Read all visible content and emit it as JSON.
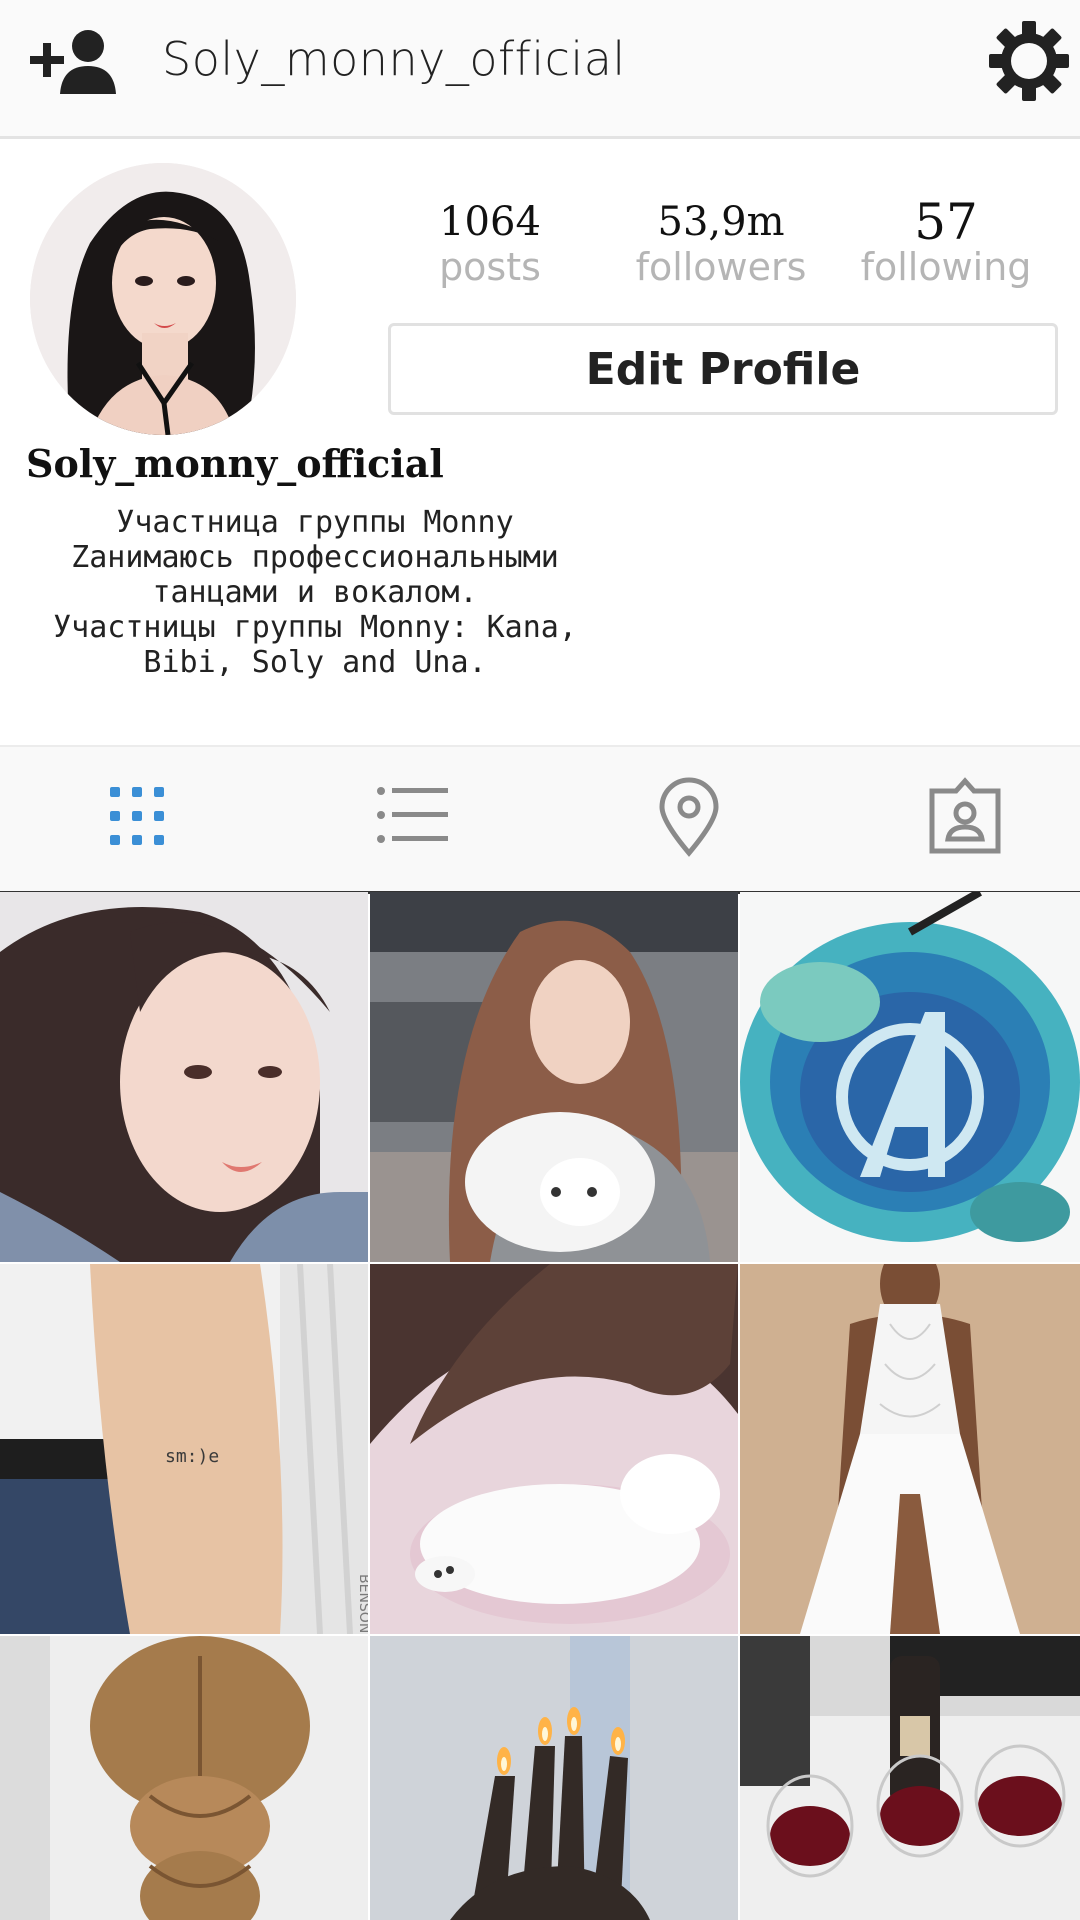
{
  "header": {
    "username": "Soly_monny_official",
    "add_user_icon": "add-user-icon",
    "settings_icon": "gear-icon"
  },
  "profile": {
    "avatar_icon": "avatar",
    "stats": {
      "posts": {
        "value": "1064",
        "label": "posts"
      },
      "followers": {
        "value": "53,9m",
        "label": "followers"
      },
      "following": {
        "value": "57",
        "label": "following"
      }
    },
    "edit_button_label": "Edit Profile",
    "display_name": "Soly_monny_official",
    "bio_lines": [
      "Участница группы Monny",
      "Zанимаюсь профессиональными",
      "танцами и вокалом.",
      "Участницы группы Monny: Kana,",
      "Bibi, Soly and Una."
    ]
  },
  "tabs": [
    {
      "icon": "grid-icon",
      "active": true
    },
    {
      "icon": "list-icon",
      "active": false
    },
    {
      "icon": "location-pin-icon",
      "active": false
    },
    {
      "icon": "tagged-photos-icon",
      "active": false
    }
  ],
  "posts": {
    "tiles": [
      {
        "subject": "portrait photo"
      },
      {
        "subject": "girl with white puppy"
      },
      {
        "subject": "watercolor A logo"
      },
      {
        "subject": "forearm tattoo"
      },
      {
        "subject": "sleeping white kitten"
      },
      {
        "subject": "white lace dress"
      },
      {
        "subject": "braided hair"
      },
      {
        "subject": "fingers with candle flames"
      },
      {
        "subject": "wine glasses"
      }
    ],
    "tattoo_text": "sm:)e",
    "watermark_text": "BENSON"
  },
  "colors": {
    "active_tab": "#3b8fd6",
    "inactive_tab": "#8a8a8a",
    "stat_label": "#b5b5b5",
    "divider": "#333333"
  }
}
